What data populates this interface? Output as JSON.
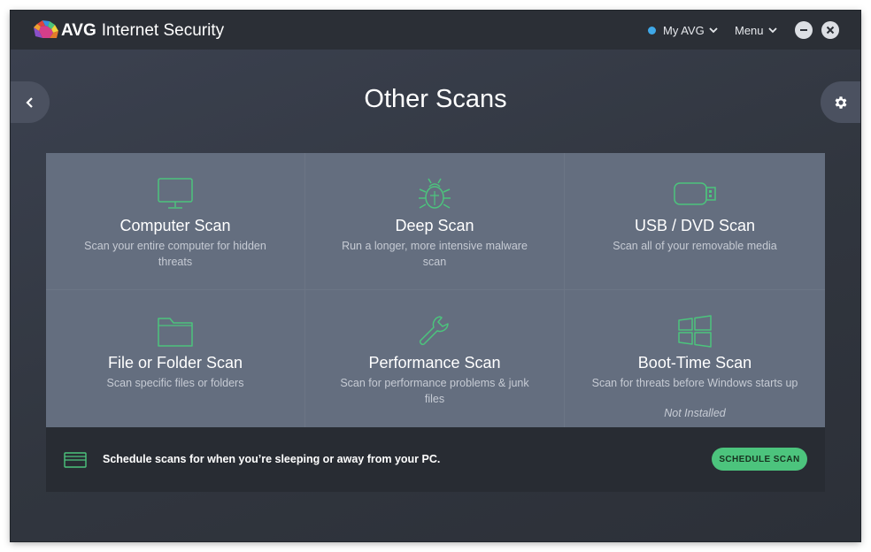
{
  "titlebar": {
    "brand": "AVG",
    "product": "Internet Security",
    "my_avg_label": "My AVG",
    "menu_label": "Menu"
  },
  "page": {
    "title": "Other Scans"
  },
  "tiles": [
    {
      "name": "Computer Scan",
      "description": "Scan your entire computer for hidden threats",
      "icon": "monitor-icon"
    },
    {
      "name": "Deep Scan",
      "description": "Run a longer, more intensive malware scan",
      "icon": "bug-icon"
    },
    {
      "name": "USB / DVD Scan",
      "description": "Scan all of your removable media",
      "icon": "usb-icon"
    },
    {
      "name": "File or Folder Scan",
      "description": "Scan specific files or folders",
      "icon": "folder-icon"
    },
    {
      "name": "Performance Scan",
      "description": "Scan for performance problems & junk files",
      "icon": "wrench-icon"
    },
    {
      "name": "Boot-Time Scan",
      "description": "Scan for threats before Windows starts up",
      "note": "Not Installed",
      "icon": "windows-icon"
    }
  ],
  "schedule": {
    "text": "Schedule scans for when you’re sleeping or away from your PC.",
    "button_label": "SCHEDULE SCAN"
  },
  "colors": {
    "accent_green": "#4cc47d",
    "status_dot_blue": "#3fa8e8",
    "titlebar_bg": "#2b2f36"
  }
}
